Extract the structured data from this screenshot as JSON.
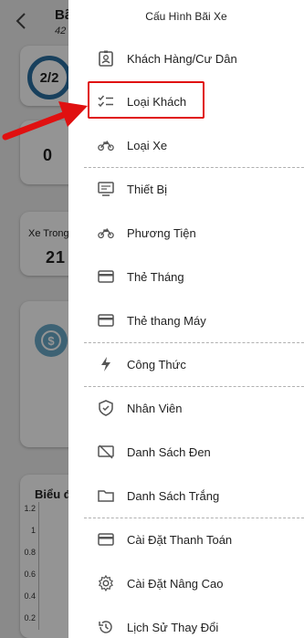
{
  "background": {
    "title": "Bã",
    "subtitle": "42",
    "ring_value": "2/2",
    "count_value": "0",
    "xe_trong_label": "Xe Trong",
    "xe_trong_value": "21",
    "chart_title": "Biểu đ",
    "y_ticks": [
      "1.2",
      "1",
      "0.8",
      "0.6",
      "0.4",
      "0.2"
    ]
  },
  "drawer": {
    "title": "Cấu Hình Bãi Xe",
    "items": [
      {
        "label": "Khách Hàng/Cư Dân",
        "icon": "id-badge-icon"
      },
      {
        "label": "Loại Khách",
        "icon": "checklist-icon"
      },
      {
        "label": "Loại Xe",
        "icon": "motorbike-icon"
      },
      {
        "label": "Thiết Bị",
        "icon": "device-icon"
      },
      {
        "label": "Phương Tiện",
        "icon": "motorbike-icon"
      },
      {
        "label": "Thẻ Tháng",
        "icon": "card-icon"
      },
      {
        "label": "Thẻ thang Máy",
        "icon": "card-icon"
      },
      {
        "label": "Công Thức",
        "icon": "lightning-icon"
      },
      {
        "label": "Nhân Viên",
        "icon": "shield-icon"
      },
      {
        "label": "Danh Sách Đen",
        "icon": "blocked-screen-icon"
      },
      {
        "label": "Danh Sách Trắng",
        "icon": "folder-icon"
      },
      {
        "label": "Cài Đặt Thanh Toán",
        "icon": "card-icon"
      },
      {
        "label": "Cài Đặt Nâng Cao",
        "icon": "gear-icon"
      },
      {
        "label": "Lịch Sử Thay Đổi",
        "icon": "history-icon"
      }
    ]
  },
  "colors": {
    "highlight": "#e01010",
    "arrow": "#e01010",
    "ring": "#2a6fa0",
    "coin": "#6aa9c8"
  }
}
